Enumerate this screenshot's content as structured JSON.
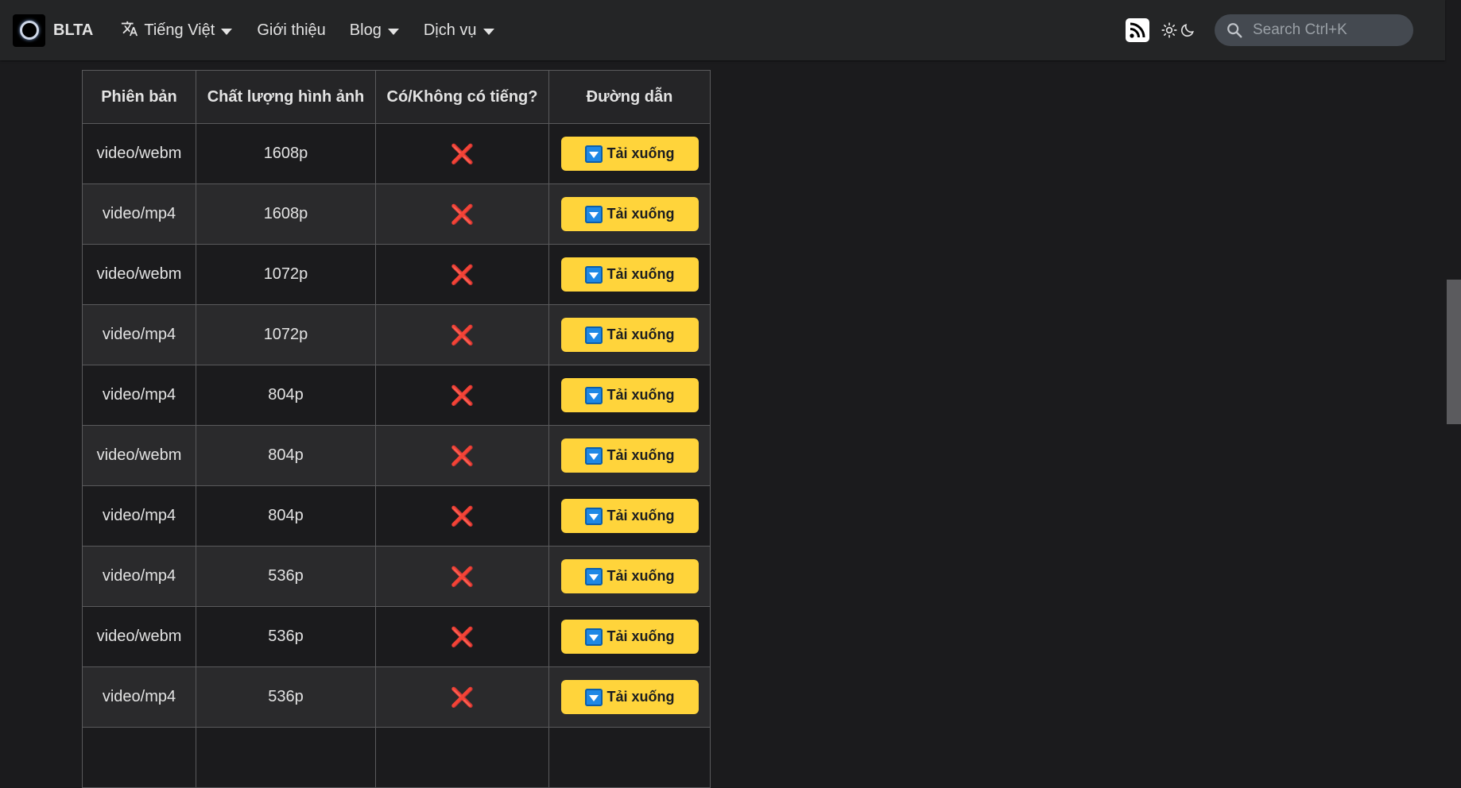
{
  "navbar": {
    "brand": "BLTA",
    "language": "Tiếng Việt",
    "about": "Giới thiệu",
    "blog": "Blog",
    "services": "Dịch vụ",
    "search_placeholder": "Search Ctrl+K"
  },
  "table": {
    "headers": [
      "Phiên bản",
      "Chất lượng hình ảnh",
      "Có/Không có tiếng?",
      "Đường dẫn"
    ],
    "rows": [
      {
        "format": "video/webm",
        "quality": "1608p",
        "audio": "❌",
        "link": "Tải xuống"
      },
      {
        "format": "video/mp4",
        "quality": "1608p",
        "audio": "❌",
        "link": "Tải xuống"
      },
      {
        "format": "video/webm",
        "quality": "1072p",
        "audio": "❌",
        "link": "Tải xuống"
      },
      {
        "format": "video/mp4",
        "quality": "1072p",
        "audio": "❌",
        "link": "Tải xuống"
      },
      {
        "format": "video/mp4",
        "quality": "804p",
        "audio": "❌",
        "link": "Tải xuống"
      },
      {
        "format": "video/webm",
        "quality": "804p",
        "audio": "❌",
        "link": "Tải xuống"
      },
      {
        "format": "video/mp4",
        "quality": "804p",
        "audio": "❌",
        "link": "Tải xuống"
      },
      {
        "format": "video/mp4",
        "quality": "536p",
        "audio": "❌",
        "link": "Tải xuống"
      },
      {
        "format": "video/webm",
        "quality": "536p",
        "audio": "❌",
        "link": "Tải xuống"
      },
      {
        "format": "video/mp4",
        "quality": "536p",
        "audio": "❌",
        "link": "Tải xuống"
      },
      {
        "format": "",
        "quality": "",
        "audio": "",
        "link": ""
      }
    ]
  },
  "icons": {
    "logo": "ring-logo-icon",
    "language": "translate-icon",
    "rss": "rss-icon",
    "theme": "sun-moon-icon",
    "search": "search-icon",
    "download": "down-arrow-button-icon",
    "no_audio": "cross-mark-icon"
  },
  "colors": {
    "background": "#1b1b1d",
    "navbar": "#242526",
    "button": "#ffd43b",
    "cross": "#e0311f"
  }
}
